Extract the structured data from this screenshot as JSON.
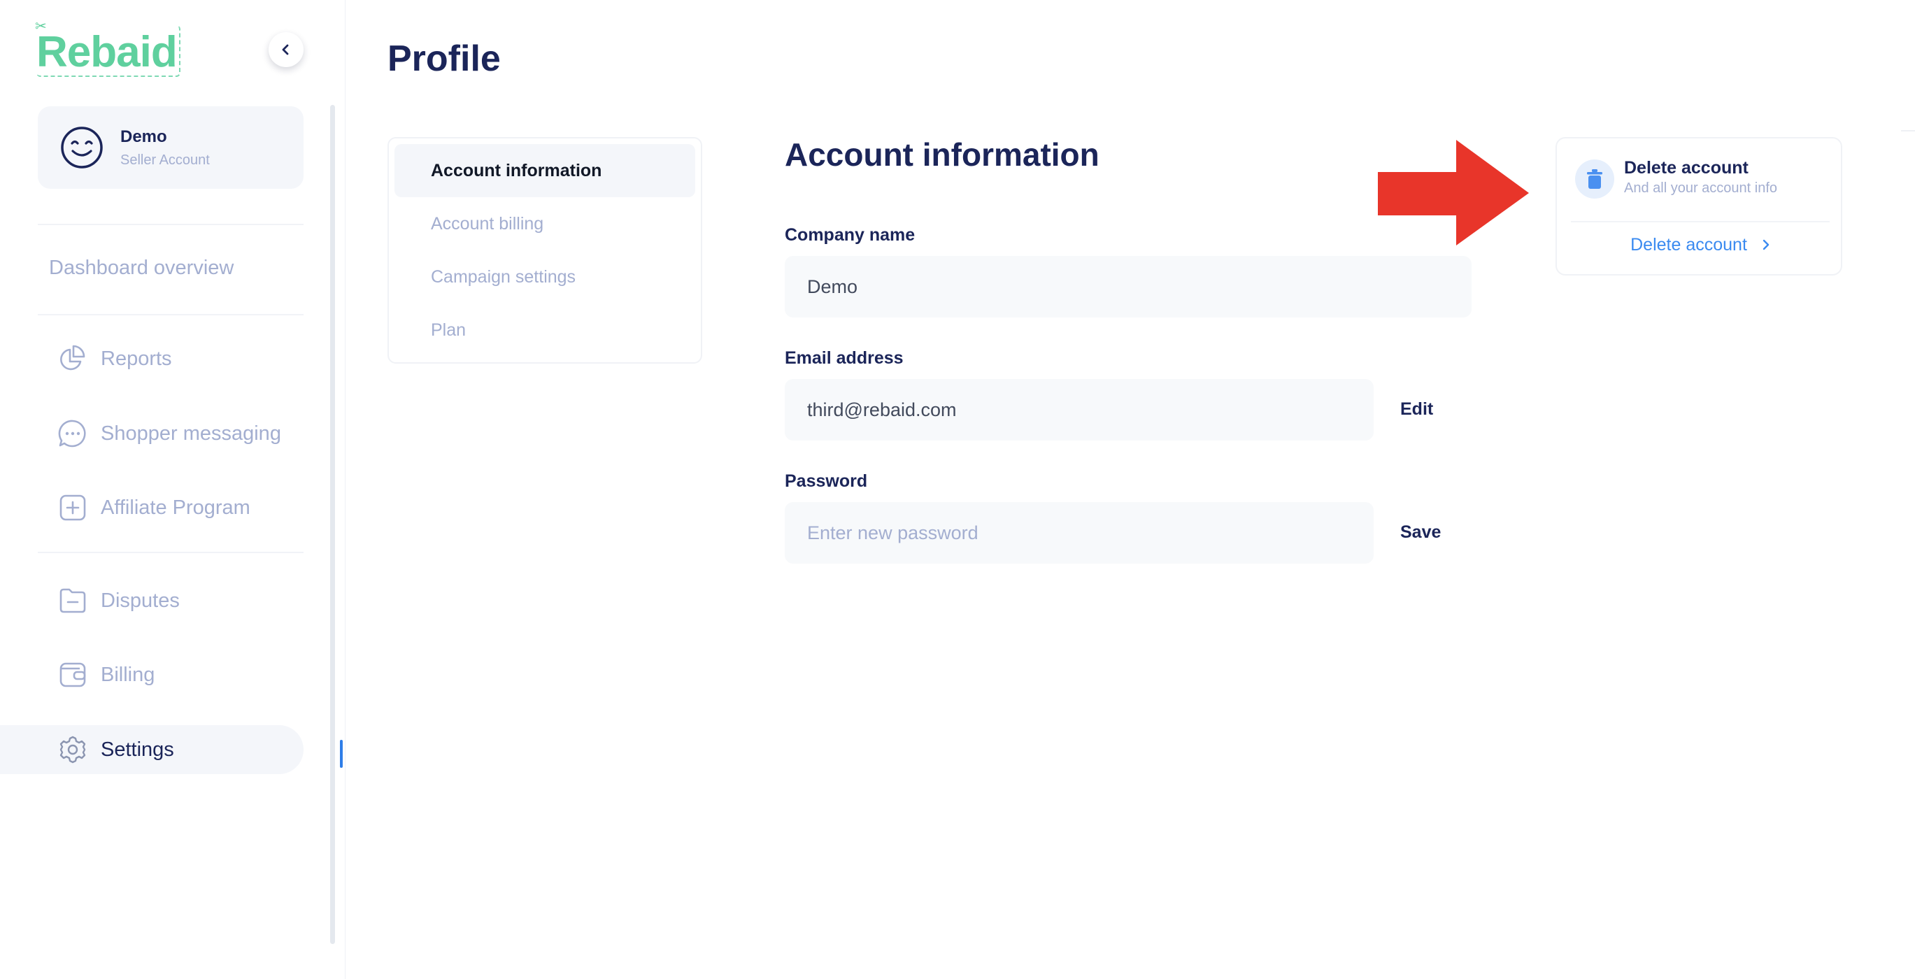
{
  "brand": {
    "logo_text": "Rebaid"
  },
  "account": {
    "name": "Demo",
    "role": "Seller Account"
  },
  "sidebar": {
    "overview_label": "Dashboard overview",
    "items": [
      {
        "label": "Reports",
        "icon": "pie-chart-icon"
      },
      {
        "label": "Shopper messaging",
        "icon": "chat-bubble-icon"
      },
      {
        "label": "Affiliate Program",
        "icon": "plus-square-icon"
      },
      {
        "label": "Disputes",
        "icon": "folder-minus-icon"
      },
      {
        "label": "Billing",
        "icon": "wallet-icon"
      },
      {
        "label": "Settings",
        "icon": "gear-icon",
        "active": true
      }
    ]
  },
  "page": {
    "title": "Profile"
  },
  "subnav": {
    "items": [
      {
        "label": "Account information",
        "active": true
      },
      {
        "label": "Account billing"
      },
      {
        "label": "Campaign settings"
      },
      {
        "label": "Plan"
      }
    ]
  },
  "form": {
    "section_title": "Account information",
    "company": {
      "label": "Company name",
      "value": "Demo"
    },
    "email": {
      "label": "Email address",
      "value": "third@rebaid.com",
      "action": "Edit"
    },
    "password": {
      "label": "Password",
      "placeholder": "Enter new password",
      "action": "Save"
    }
  },
  "delete_card": {
    "title": "Delete account",
    "subtitle": "And all your account info",
    "link_label": "Delete account"
  },
  "colors": {
    "brand_green": "#5fd09e",
    "navy": "#1b2559",
    "muted": "#a3aed0",
    "link_blue": "#3a8af0",
    "arrow_red": "#e8352a"
  }
}
